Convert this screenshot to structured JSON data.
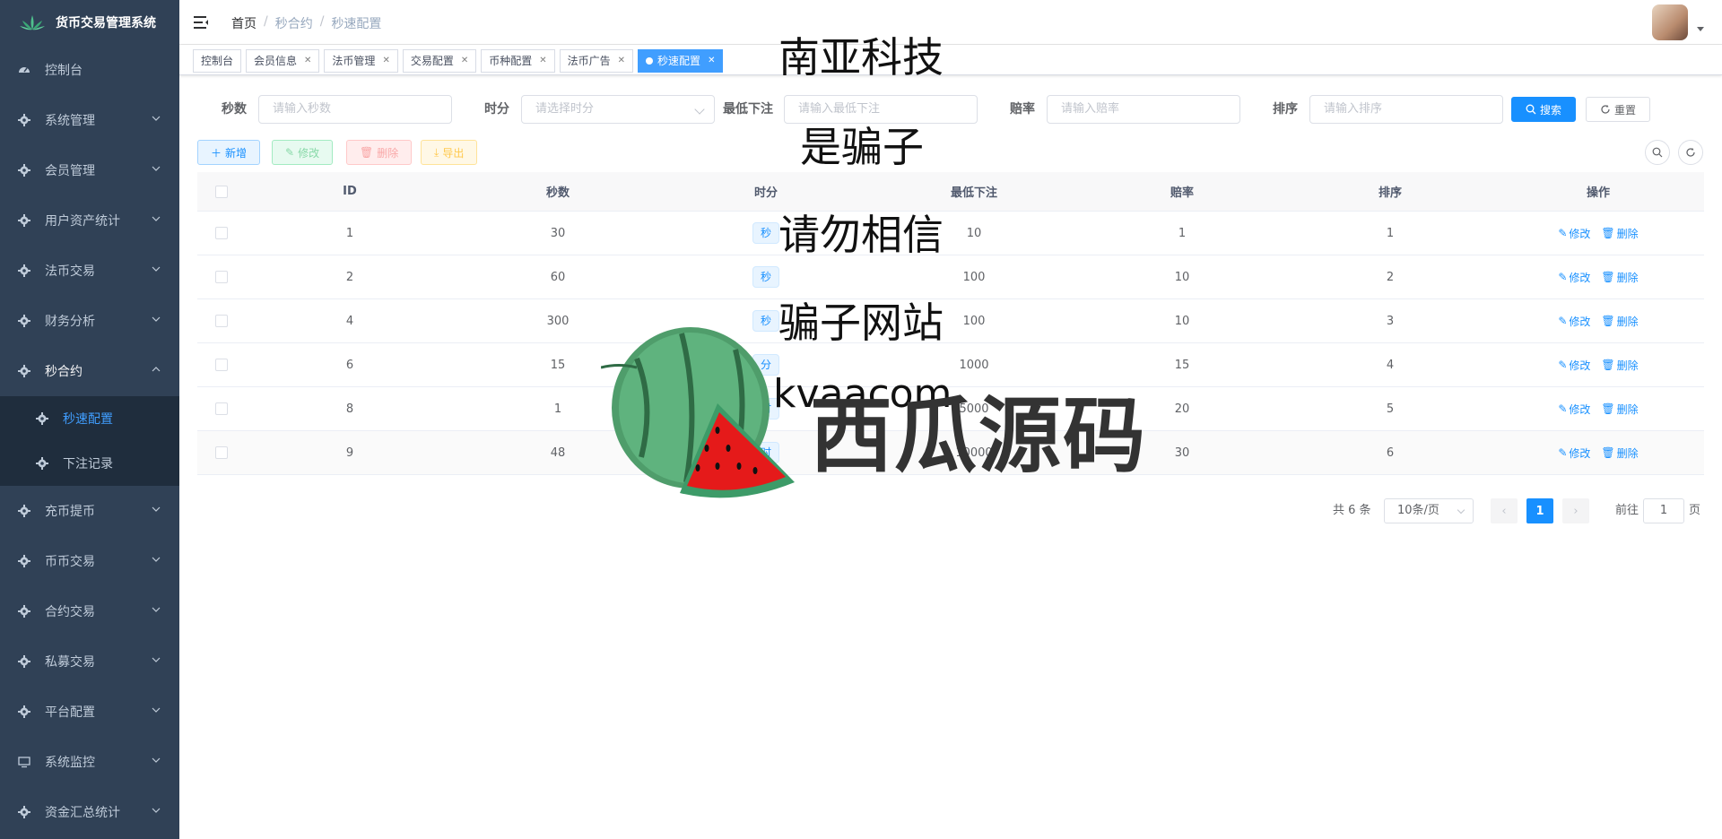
{
  "app": {
    "title": "货币交易管理系统"
  },
  "sidebar": {
    "items": [
      {
        "label": "控制台",
        "icon": "dashboard-icon"
      },
      {
        "label": "系统管理",
        "icon": "gear-icon"
      },
      {
        "label": "会员管理",
        "icon": "gear-icon"
      },
      {
        "label": "用户资产统计",
        "icon": "gear-icon"
      },
      {
        "label": "法币交易",
        "icon": "gear-icon"
      },
      {
        "label": "财务分析",
        "icon": "gear-icon"
      },
      {
        "label": "秒合约",
        "icon": "gear-icon"
      },
      {
        "label": "充币提币",
        "icon": "gear-icon"
      },
      {
        "label": "币币交易",
        "icon": "gear-icon"
      },
      {
        "label": "合约交易",
        "icon": "gear-icon"
      },
      {
        "label": "私募交易",
        "icon": "gear-icon"
      },
      {
        "label": "平台配置",
        "icon": "gear-icon"
      },
      {
        "label": "系统监控",
        "icon": "monitor-icon"
      },
      {
        "label": "资金汇总统计",
        "icon": "gear-icon"
      }
    ],
    "sub": [
      {
        "label": "秒速配置"
      },
      {
        "label": "下注记录"
      }
    ]
  },
  "breadcrumb": [
    "首页",
    "秒合约",
    "秒速配置"
  ],
  "tags": [
    {
      "label": "控制台",
      "closable": false
    },
    {
      "label": "会员信息",
      "closable": true
    },
    {
      "label": "法币管理",
      "closable": true
    },
    {
      "label": "交易配置",
      "closable": true
    },
    {
      "label": "币种配置",
      "closable": true
    },
    {
      "label": "法币广告",
      "closable": true
    },
    {
      "label": "秒速配置",
      "closable": true,
      "active": true
    }
  ],
  "form": {
    "seconds": {
      "label": "秒数",
      "placeholder": "请输入秒数"
    },
    "unit": {
      "label": "时分",
      "placeholder": "请选择时分"
    },
    "min_bet": {
      "label": "最低下注",
      "placeholder": "请输入最低下注"
    },
    "odds": {
      "label": "赔率",
      "placeholder": "请输入赔率"
    },
    "sort": {
      "label": "排序",
      "placeholder": "请输入排序"
    },
    "search_label": "搜索",
    "reset_label": "重置"
  },
  "toolbar": {
    "add": "新增",
    "edit": "修改",
    "delete": "删除",
    "export": "导出"
  },
  "table": {
    "headers": [
      "ID",
      "秒数",
      "时分",
      "最低下注",
      "赔率",
      "排序",
      "操作"
    ],
    "rows": [
      {
        "id": "1",
        "seconds": "30",
        "unit": "秒",
        "min_bet": "10",
        "odds": "1",
        "sort": "1"
      },
      {
        "id": "2",
        "seconds": "60",
        "unit": "秒",
        "min_bet": "100",
        "odds": "10",
        "sort": "2"
      },
      {
        "id": "4",
        "seconds": "300",
        "unit": "秒",
        "min_bet": "100",
        "odds": "10",
        "sort": "3"
      },
      {
        "id": "6",
        "seconds": "15",
        "unit": "分",
        "min_bet": "1000",
        "odds": "15",
        "sort": "4"
      },
      {
        "id": "8",
        "seconds": "1",
        "unit": "时",
        "min_bet": "5000",
        "odds": "20",
        "sort": "5"
      },
      {
        "id": "9",
        "seconds": "48",
        "unit": "时",
        "min_bet": "10000",
        "odds": "30",
        "sort": "6"
      }
    ],
    "op_edit": "修改",
    "op_delete": "删除"
  },
  "pagination": {
    "total": "共 6 条",
    "page_size": "10条/页",
    "current": "1",
    "goto": "前往",
    "goto_value": "1",
    "page_unit": "页"
  },
  "watermark": {
    "lines": [
      "南亚科技",
      "是骗子",
      "请勿相信",
      "骗子网站",
      "kvaacom"
    ],
    "brand": "西瓜源码"
  },
  "colors": {
    "sidebar_bg": "#304156",
    "accent": "#1890ff",
    "active_sub": "#409eff"
  }
}
